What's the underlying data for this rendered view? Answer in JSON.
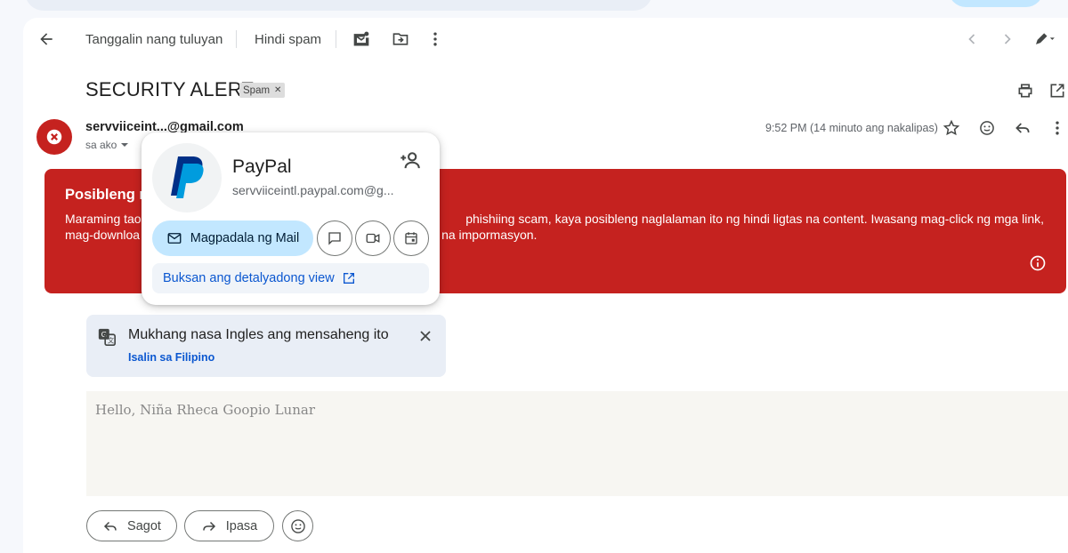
{
  "toolbar": {
    "mark_not_phishing": "Tanggalin nang tuluyan",
    "not_spam": "Hindi spam"
  },
  "message": {
    "subject": "SECURITY ALERT",
    "label_chip": "Spam",
    "sender_display": "servviiceint...@gmail.com",
    "recipient": "sa ako",
    "timestamp": "9:52 PM (14 minuto ang nakalipas)"
  },
  "alert": {
    "title_visible": "Posibleng m",
    "line1_left": "Maraming tao",
    "line1_right": "phishiing scam, kaya posibleng naglalaman ito ng hindi ligtas na content. Iwasang mag-click ng mga link,",
    "line2_left": "mag-downloa",
    "line2_right": "na impormasyon.",
    "color": "#c5221f"
  },
  "translate": {
    "title": "Mukhang nasa Ingles ang mensaheng ito",
    "link": "Isalin sa Filipino"
  },
  "body": {
    "greeting": "Hello, Niña Rheca Goopio Lunar"
  },
  "actions": {
    "reply": "Sagot",
    "forward": "Ipasa"
  },
  "contact_card": {
    "name": "PayPal",
    "email": "servviiceintl.paypal.com@g...",
    "send_mail": "Magpadala ng Mail",
    "open_detail": "Buksan ang detalyadong view"
  },
  "colors": {
    "accent_blue": "#0b57d0",
    "chip_blue": "#c2e7ff",
    "danger_red": "#c5221f"
  }
}
